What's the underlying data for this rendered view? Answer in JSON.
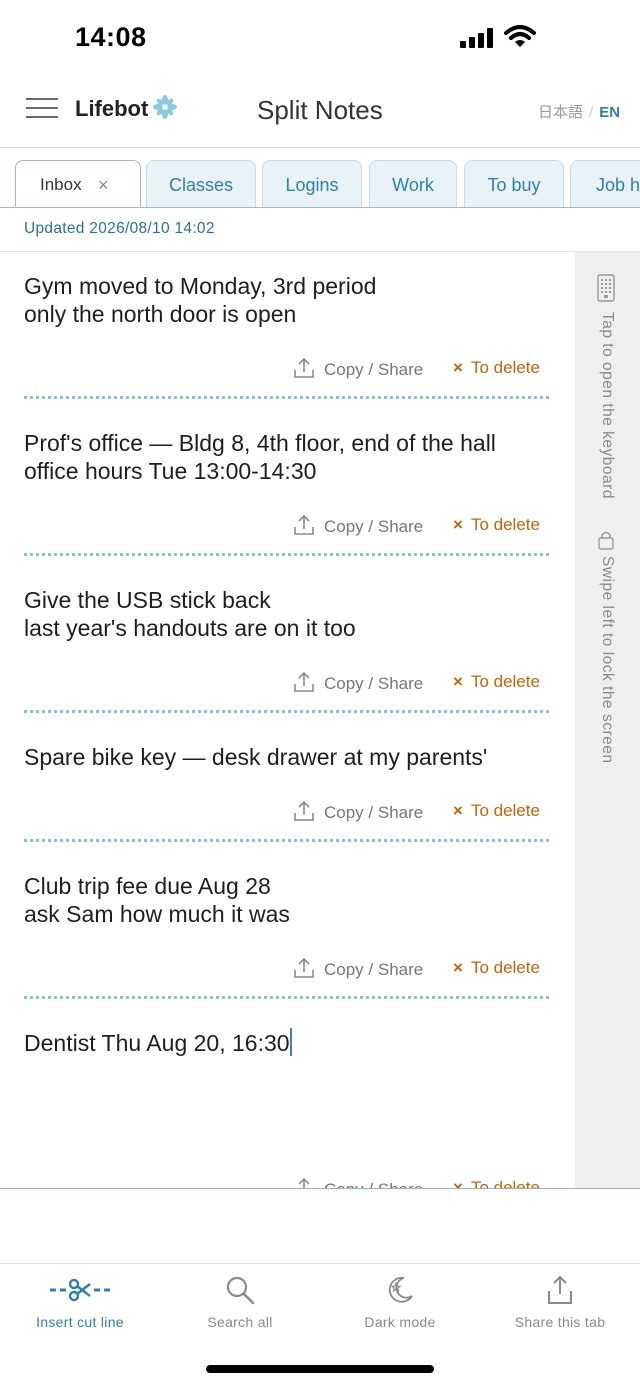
{
  "status": {
    "time": "14:08"
  },
  "header": {
    "logo": "Lifebot",
    "title": "Split Notes",
    "lang_ja": "日本語",
    "lang_sep": "/",
    "lang_en": "EN"
  },
  "tabs": [
    {
      "label": "Inbox",
      "active": true,
      "close": "×"
    },
    {
      "label": "Classes"
    },
    {
      "label": "Logins"
    },
    {
      "label": "Work"
    },
    {
      "label": "To buy"
    },
    {
      "label": "Job h"
    }
  ],
  "updated": "Updated 2026/08/10 14:02",
  "notes": [
    {
      "text": "Gym moved to Monday, 3rd period\nonly the north door is open"
    },
    {
      "text": "Prof's office — Bldg 8, 4th floor, end of the hall\noffice hours Tue 13:00-14:30"
    },
    {
      "text": "Give the USB stick back\nlast year's handouts are on it too"
    },
    {
      "text": "Spare bike key — desk drawer at my parents'"
    },
    {
      "text": "Club trip fee due Aug 28\nask Sam how much it was"
    },
    {
      "text": "Dentist Thu Aug 20, 16:30"
    }
  ],
  "note_actions": {
    "copy_label": "Copy / Share",
    "delete_x": "×",
    "delete_label": "To delete"
  },
  "side": {
    "keyboard_hint": "Tap to open the keyboard",
    "lock_hint": "Swipe left to lock the screen"
  },
  "toolbar": [
    {
      "label": "Insert cut line",
      "icon": "scissors-cut-line-icon"
    },
    {
      "label": "Search all",
      "icon": "search-icon"
    },
    {
      "label": "Dark mode",
      "icon": "moon-star-icon"
    },
    {
      "label": "Share this tab",
      "icon": "share-icon"
    }
  ],
  "colors": {
    "accent": "#2f80a8",
    "delete": "#c8620a",
    "dots": "#8bc1d6"
  }
}
